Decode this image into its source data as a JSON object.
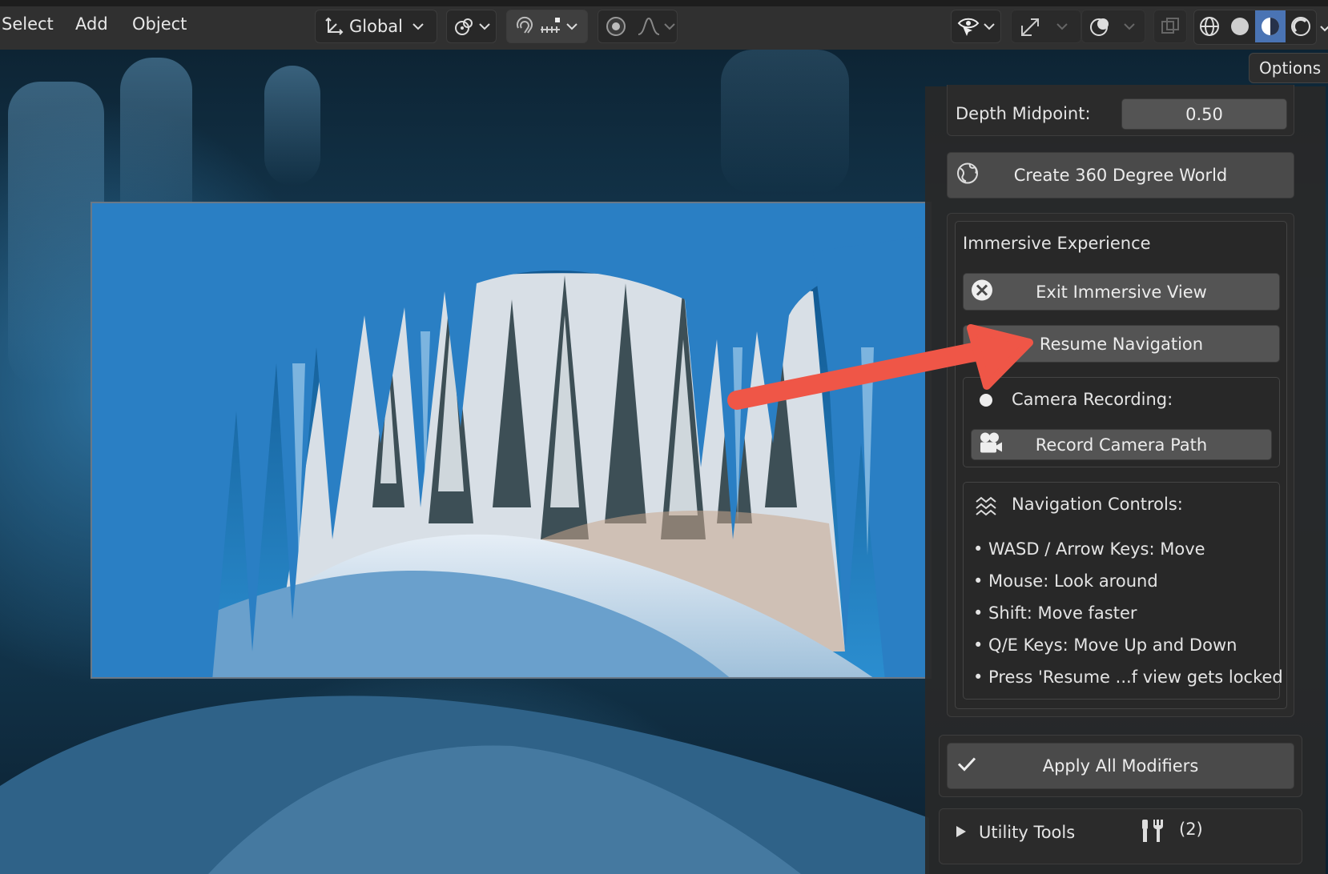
{
  "header": {
    "menu": [
      "Select",
      "Add",
      "Object"
    ],
    "orientation": "Global",
    "icons": {
      "orientation": "transform-axes-icon",
      "pivot": "pivot-point-icon",
      "snap": "snap-magnet-icon",
      "snap_target": "snap-increment-icon",
      "proportional": "proportional-edit-icon",
      "falloff": "falloff-curve-icon",
      "visibility": "eye-cursor-icon",
      "gizmo": "gizmo-arrow-icon",
      "overlay": "overlay-circles-icon",
      "xray": "xray-icon",
      "shading": [
        "wireframe-icon",
        "solid-icon",
        "material-preview-icon",
        "rendered-icon"
      ]
    }
  },
  "viewport": {
    "options_label": "Options"
  },
  "panel": {
    "depth_midpoint": {
      "label": "Depth Midpoint:",
      "value": "0.50"
    },
    "create_world_button": {
      "label": "Create 360 Degree World",
      "icon": "globe-icon"
    },
    "immersive": {
      "title": "Immersive Experience",
      "exit_button": {
        "label": "Exit Immersive View",
        "icon": "close-circle-icon"
      },
      "resume_button": {
        "label": "Resume Navigation",
        "icon": "navigation-icon"
      },
      "camera_recording": {
        "label": "Camera Recording:",
        "icon": "record-dot-icon"
      },
      "record_button": {
        "label": "Record Camera Path",
        "icon": "movie-camera-icon"
      },
      "nav_controls": {
        "title": "Navigation Controls:",
        "icon": "waves-icon",
        "items": [
          "• WASD / Arrow Keys: Move",
          "• Mouse: Look around",
          "• Shift: Move faster",
          "• Q/E Keys: Move Up and Down",
          "• Press 'Resume ...f view gets locked"
        ]
      }
    },
    "apply_button": {
      "label": "Apply All Modifiers",
      "icon": "checkmark-icon"
    },
    "utility": {
      "label": "Utility Tools",
      "count": "(2)",
      "icon": "tools-icon",
      "expand_icon": "triangle-right-icon"
    }
  },
  "annotation": {
    "color": "#f0584a",
    "icon": "red-arrow-annotation"
  },
  "colors": {
    "accent": "#4a74b4",
    "header_bg": "#303030",
    "button_bg": "#545454"
  }
}
